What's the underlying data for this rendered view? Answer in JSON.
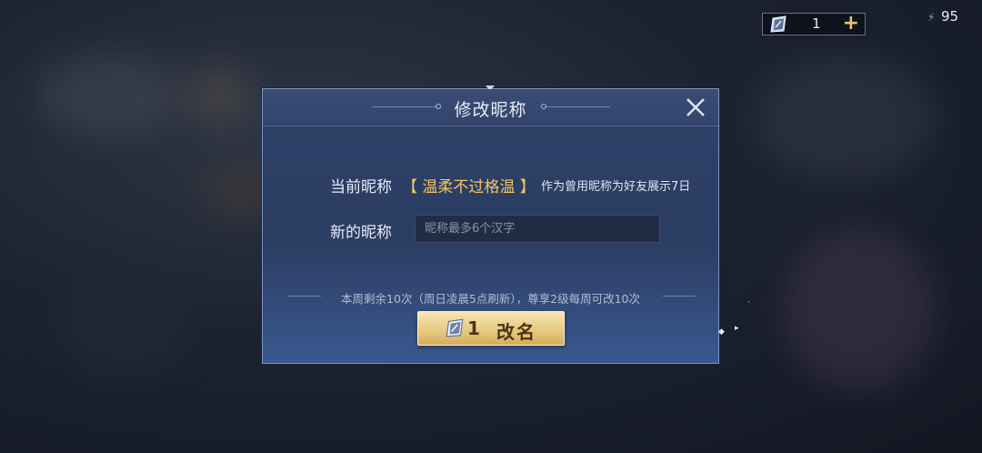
{
  "topbar": {
    "rename_card_count": "1",
    "add_label": "+",
    "signal_icon": "lightning-icon",
    "signal_value": "95"
  },
  "dialog": {
    "title": "修改昵称",
    "close_icon": "close-icon",
    "current_label": "当前昵称",
    "current_name": "【 温柔不过格温 】",
    "current_note": "作为曾用昵称为好友展示7日",
    "new_label": "新的昵称",
    "input_placeholder": "昵称最多6个汉字",
    "input_value": "",
    "remaining_info": "本周剩余10次（周日凌晨5点刷新），尊享2级每周可改10次",
    "confirm_cost": "1",
    "confirm_label": "改名"
  },
  "colors": {
    "accent_gold": "#f2c564",
    "button_gold": "#e8ca82",
    "dialog_blue": "#2f4168"
  }
}
